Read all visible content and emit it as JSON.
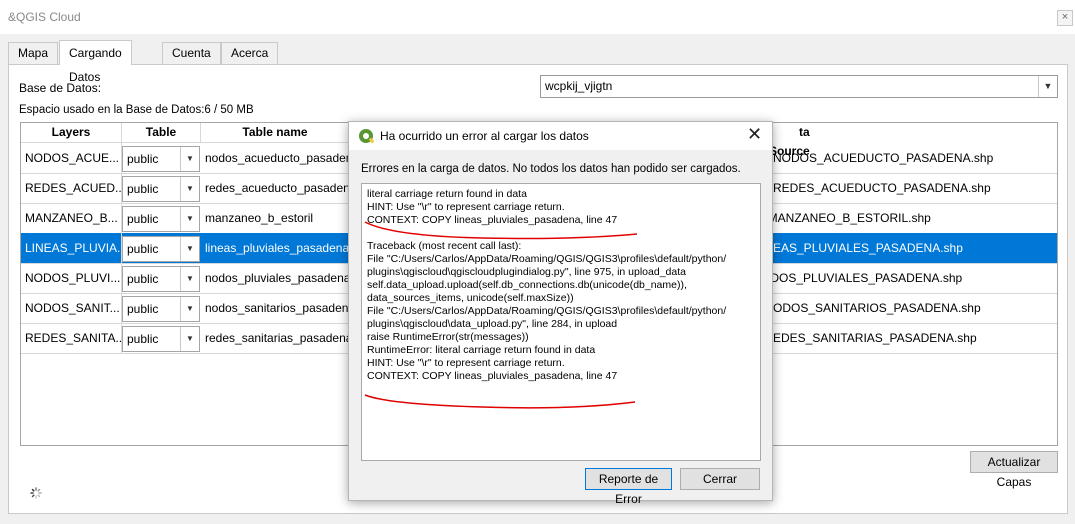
{
  "window": {
    "title": "&QGIS Cloud",
    "close_glyph": "×"
  },
  "tabs": [
    "Mapa",
    "Cargando Datos",
    "Cuenta",
    "Acerca de"
  ],
  "database": {
    "label": "Base de Datos:",
    "value": "wcpkij_vjigtn",
    "usage": "Espacio usado en la Base de Datos:6 / 50 MB"
  },
  "table": {
    "headers": [
      "Layers",
      "Table Schema",
      "Table name",
      "ta Source"
    ],
    "rows": [
      {
        "layer": "NODOS_ACUE...",
        "schema": "public",
        "name": "nodos_acueducto_pasadena",
        "source": "D/NODOS_ACUEDUCTO_PASADENA.shp"
      },
      {
        "layer": "REDES_ACUED...",
        "schema": "public",
        "name": "redes_acueducto_pasadena",
        "source": "D/REDES_ACUEDUCTO_PASADENA.shp"
      },
      {
        "layer": "MANZANEO_B...",
        "schema": "public",
        "name": "manzaneo_b_estoril",
        "source": "./MANZANEO_B_ESTORIL.shp"
      },
      {
        "layer": "LINEAS_PLUVIA...",
        "schema": "public",
        "name": "lineas_pluviales_pasadena",
        "source": "INEAS_PLUVIALES_PASADENA.shp"
      },
      {
        "layer": "NODOS_PLUVI...",
        "schema": "public",
        "name": "nodos_pluviales_pasadena",
        "source": "ODOS_PLUVIALES_PASADENA.shp"
      },
      {
        "layer": "NODOS_SANIT...",
        "schema": "public",
        "name": "nodos_sanitarios_pasadena",
        "source": "/NODOS_SANITARIOS_PASADENA.shp"
      },
      {
        "layer": "REDES_SANITA...",
        "schema": "public",
        "name": "redes_sanitarias_pasadena",
        "source": "/REDES_SANITARIAS_PASADENA.shp"
      }
    ],
    "selected_row": 3
  },
  "refresh_button": "Actualizar Capas",
  "dialog": {
    "title": "Ha ocurrido un error al cargar los datos",
    "close_glyph": "✕",
    "message": "Errores en la carga de datos. No todos los datos han podido ser cargados.",
    "lines": [
      "literal carriage return found in data",
      "HINT:  Use \"\\r\" to represent carriage return.",
      "CONTEXT:  COPY lineas_pluviales_pasadena, line 47",
      "",
      "Traceback (most recent call last):",
      "  File \"C:/Users/Carlos/AppData/Roaming/QGIS/QGIS3\\profiles\\default/python/",
      "plugins\\qgiscloud\\qgiscloudplugindialog.py\", line 975, in upload_data",
      "    self.data_upload.upload(self.db_connections.db(unicode(db_name)),",
      "data_sources_items, unicode(self.maxSize))",
      "  File \"C:/Users/Carlos/AppData/Roaming/QGIS/QGIS3\\profiles\\default/python/",
      "plugins\\qgiscloud\\data_upload.py\", line 284, in upload",
      "    raise RuntimeError(str(messages))",
      "RuntimeError: literal carriage return found in data",
      "HINT:  Use \"\\r\" to represent carriage return.",
      "CONTEXT:  COPY lineas_pluviales_pasadena, line 47"
    ],
    "buttons": {
      "report": "Reporte de Error",
      "close": "Cerrar"
    }
  },
  "colors": {
    "selection": "#0078d7",
    "annotation": "#e00000",
    "qgis_green": "#589632"
  }
}
